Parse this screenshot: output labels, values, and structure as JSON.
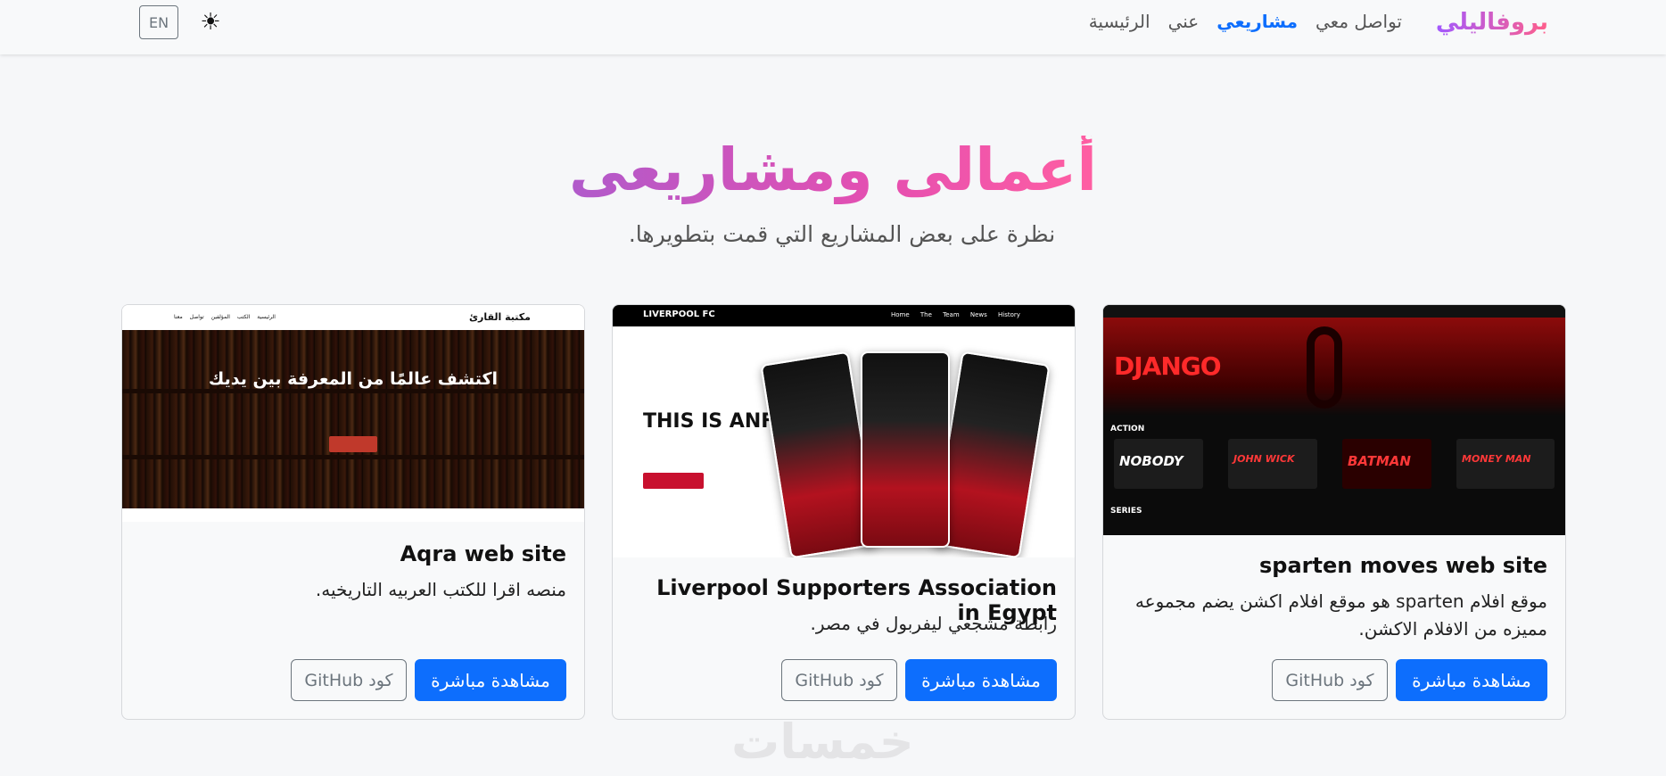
{
  "navbar": {
    "brand": "بروفاليلي",
    "links": [
      {
        "label": "الرئيسية",
        "active": false
      },
      {
        "label": "عني",
        "active": false
      },
      {
        "label": "مشاريعي",
        "active": true
      },
      {
        "label": "تواصل معي",
        "active": false
      }
    ],
    "lang_button": "EN",
    "theme_icon": "☀"
  },
  "section": {
    "title": "أعمالى ومشاريعى",
    "subtitle": "نظرة على بعض المشاريع التي قمت بتطويرها."
  },
  "projects": [
    {
      "title": "sparten moves web site",
      "description": "موقع افلام sparten هو موقع افلام اكشن يضم مجموعه مميزه من الافلام الاكشن.",
      "live_label": "مشاهدة مباشرة",
      "code_label": "كود GitHub",
      "preview": {
        "logo": "DJANGO",
        "row1": "ACTION",
        "row2": "SERIES",
        "tiles": [
          "NOBODY",
          "JOHN WICK",
          "BATMAN",
          "MONEY MAN"
        ]
      }
    },
    {
      "title": "Liverpool Supporters Association in Egypt",
      "description": "رابطة مشجعي ليفربول في مصر.",
      "live_label": "مشاهدة مباشرة",
      "code_label": "كود GitHub",
      "preview": {
        "logo": "LIVERPOOL FC",
        "nav": "Home The Team News History",
        "headline": "THIS IS ANFIELD"
      }
    },
    {
      "title": "Aqra web site",
      "description": "منصه اقرا للكتب العربيه التاريخيه.",
      "live_label": "مشاهدة مباشرة",
      "code_label": "كود GitHub",
      "preview": {
        "logo": "مكتبة القارئ",
        "nav": "الرئيسية الكتب المؤلفين تواصل معنا",
        "hero": "اكتشف عالمًا من المعرفة بين يديك"
      }
    }
  ],
  "watermark": "خمسات"
}
